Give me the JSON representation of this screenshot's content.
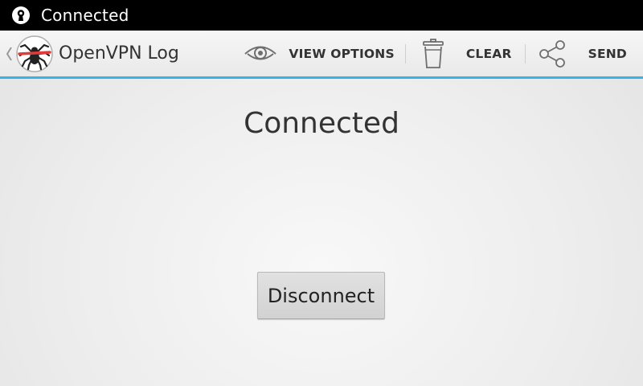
{
  "status_bar": {
    "text": "Connected",
    "icon": "openvpn-key-icon"
  },
  "action_bar": {
    "title": "OpenVPN Log",
    "app_icon": "openvpn-spider-icon",
    "actions": [
      {
        "label": "VIEW OPTIONS",
        "icon": "eye-icon"
      },
      {
        "label": "CLEAR",
        "icon": "trash-icon"
      },
      {
        "label": "SEND",
        "icon": "share-icon"
      }
    ]
  },
  "main": {
    "connection_status": "Connected",
    "disconnect_label": "Disconnect"
  },
  "colors": {
    "status_bar_bg": "#000000",
    "action_bar_accent": "#33b5e5",
    "text_primary": "#333333"
  }
}
